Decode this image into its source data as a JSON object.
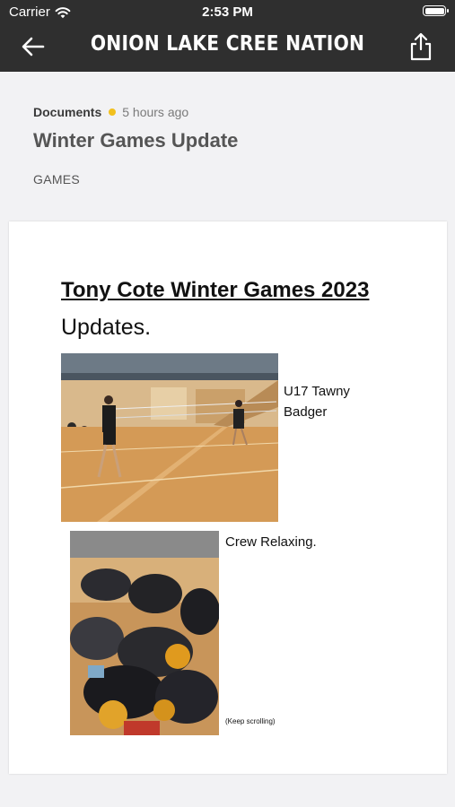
{
  "status_bar": {
    "carrier": "Carrier",
    "time": "2:53 PM"
  },
  "nav": {
    "title": "ONION LAKE CREE NATION",
    "back_icon": "arrow-left-icon",
    "share_icon": "share-icon"
  },
  "article": {
    "category": "Documents",
    "time_ago": "5 hours ago",
    "title": "Winter Games Update",
    "tag": "GAMES"
  },
  "document": {
    "heading": "Tony Cote Winter Games 2023",
    "subheading": "Updates.",
    "photos": [
      {
        "caption": "U17 Tawny Badger"
      },
      {
        "caption": "Crew Relaxing."
      }
    ],
    "footnote": "(Keep scrolling)"
  },
  "colors": {
    "header_bg": "#2f2f2f",
    "page_bg": "#f2f2f4",
    "accent_dot": "#f2c01d"
  }
}
